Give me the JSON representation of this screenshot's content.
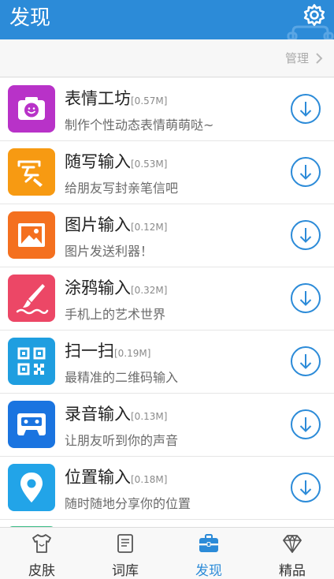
{
  "header": {
    "title": "发现",
    "bg_color": "#2c8bd8"
  },
  "manage": {
    "label": "管理"
  },
  "apps": [
    {
      "name": "表情工坊",
      "size": "[0.57M]",
      "desc": "制作个性动态表情萌萌哒~",
      "icon": "camera-smile-icon",
      "color": "#b832c8"
    },
    {
      "name": "随写输入",
      "size": "[0.53M]",
      "desc": "给朋友写封亲笔信吧",
      "icon": "handwriting-icon",
      "color": "#f79a12"
    },
    {
      "name": "图片输入",
      "size": "[0.12M]",
      "desc": "图片发送利器！",
      "icon": "picture-icon",
      "color": "#f4701f"
    },
    {
      "name": "涂鸦输入",
      "size": "[0.32M]",
      "desc": "手机上的艺术世界",
      "icon": "paintbrush-icon",
      "color": "#ec4766"
    },
    {
      "name": "扫一扫",
      "size": "[0.19M]",
      "desc": "最精准的二维码输入",
      "icon": "qr-code-icon",
      "color": "#1f9ee0"
    },
    {
      "name": "录音输入",
      "size": "[0.13M]",
      "desc": "让朋友听到你的声音",
      "icon": "cassette-icon",
      "color": "#1a74e0"
    },
    {
      "name": "位置输入",
      "size": "[0.18M]",
      "desc": "随时随地分享你的位置",
      "icon": "location-pin-icon",
      "color": "#22a4e8"
    }
  ],
  "tabs": [
    {
      "label": "皮肤",
      "icon": "tshirt-icon",
      "active": false
    },
    {
      "label": "词库",
      "icon": "book-icon",
      "active": false
    },
    {
      "label": "发现",
      "icon": "toolbox-icon",
      "active": true
    },
    {
      "label": "精品",
      "icon": "diamond-icon",
      "active": false
    }
  ],
  "accent_color": "#2c8bd8"
}
